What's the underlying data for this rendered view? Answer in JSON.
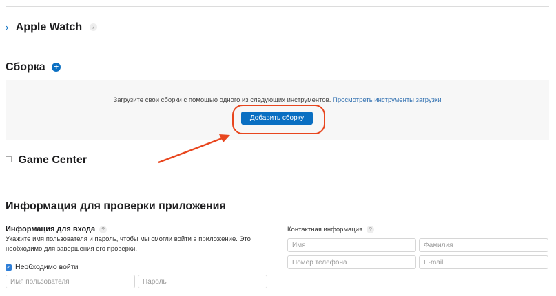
{
  "apple_watch": {
    "title": "Apple Watch",
    "help": "?"
  },
  "build": {
    "title": "Сборка",
    "upload_text": "Загрузите свои сборки с помощью одного из следующих инструментов.",
    "upload_link": "Просмотреть инструменты загрузки",
    "add_button": "Добавить сборку"
  },
  "game_center": {
    "title": "Game Center"
  },
  "review": {
    "title": "Информация для проверки приложения",
    "login": {
      "label": "Информация для входа",
      "help": "?",
      "description": "Укажите имя пользователя и пароль, чтобы мы смогли войти в приложение. Это необходимо для завершения его проверки.",
      "checkbox_label": "Необходимо войти",
      "checkbox_checked": true,
      "username_placeholder": "Имя пользователя",
      "password_placeholder": "Пароль"
    },
    "contact": {
      "label": "Контактная информация",
      "help": "?",
      "first_name_placeholder": "Имя",
      "last_name_placeholder": "Фамилия",
      "phone_placeholder": "Номер телефона",
      "email_placeholder": "E-mail"
    }
  },
  "colors": {
    "accent": "#0a6fc2",
    "annotation": "#e8461e"
  }
}
